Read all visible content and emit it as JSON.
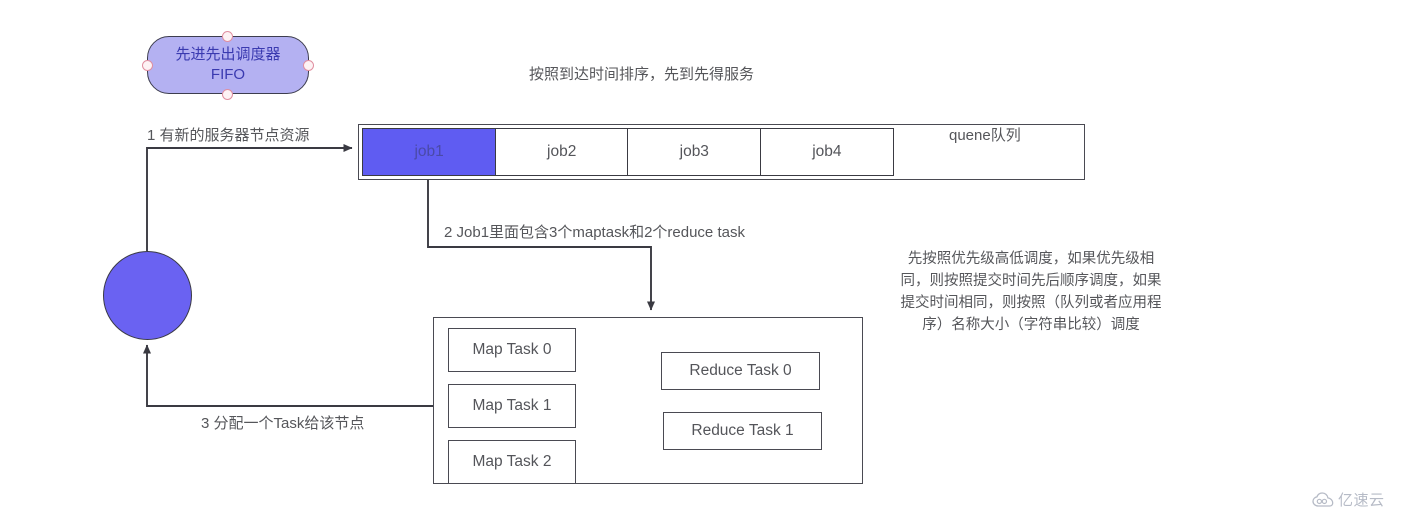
{
  "diagram": {
    "scheduler_node": {
      "line1": "先进先出调度器",
      "line2": "FIFO",
      "fill_color": "#b4b1f2",
      "handle_color": "#e08fa0"
    },
    "resource_node": {
      "label": "",
      "fill_color": "#6a62f2"
    },
    "queue": {
      "caption": "按照到达时间排序，先到先得服务",
      "arrow_label": "quene队列",
      "jobs": [
        {
          "label": "job1",
          "active": true,
          "fill_color": "#5f5cf2"
        },
        {
          "label": "job2",
          "active": false,
          "fill_color": "#ffffff"
        },
        {
          "label": "job3",
          "active": false,
          "fill_color": "#ffffff"
        },
        {
          "label": "job4",
          "active": false,
          "fill_color": "#ffffff"
        }
      ]
    },
    "flow_labels": {
      "step1": "1 有新的服务器节点资源",
      "step2": "2 Job1里面包含3个maptask和2个reduce task",
      "step3": "3 分配一个Task给该节点"
    },
    "tasks": {
      "map": [
        {
          "label": "Map Task 0"
        },
        {
          "label": "Map Task 1"
        },
        {
          "label": "Map Task 2"
        }
      ],
      "reduce": [
        {
          "label": "Reduce Task 0"
        },
        {
          "label": "Reduce Task 1"
        }
      ]
    },
    "priority_note": {
      "line1": "先按照优先级高低调度，如果优先级相",
      "line2": "同，则按照提交时间先后顺序调度，如果",
      "line3": "提交时间相同，则按照（队列或者应用程",
      "line4": "序）名称大小（字符串比较）调度"
    }
  },
  "watermark": {
    "icon": "cloud-icon",
    "text": "亿速云"
  }
}
